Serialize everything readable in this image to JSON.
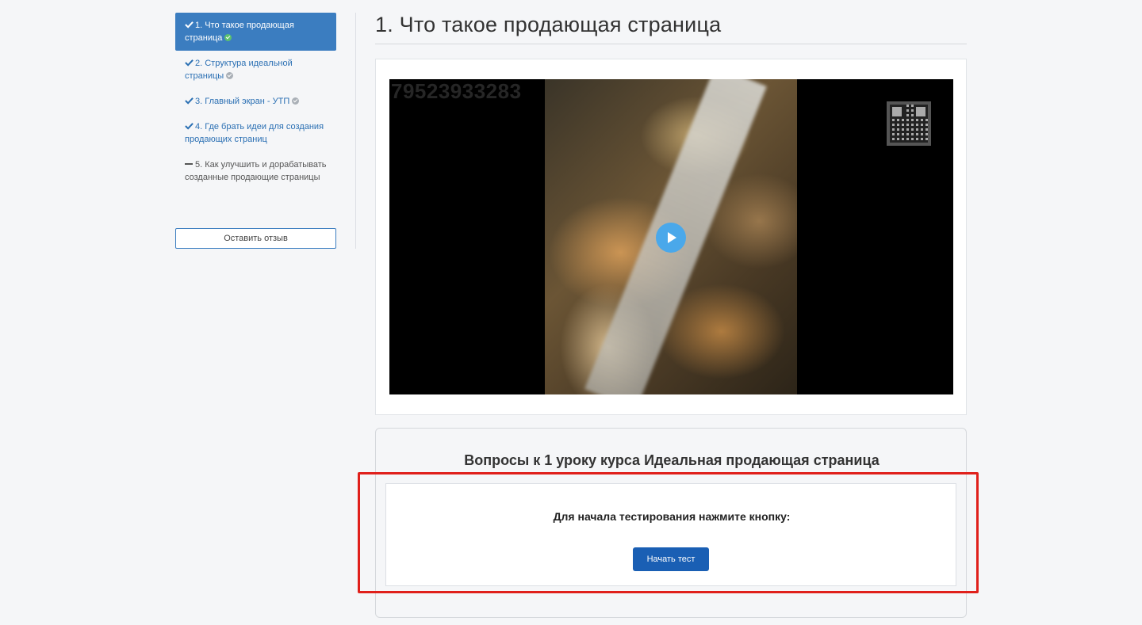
{
  "sidebar": {
    "items": [
      {
        "label": "1. Что такое продающая страница",
        "state": "done-active"
      },
      {
        "label": "2. Структура идеальной страницы",
        "state": "done"
      },
      {
        "label": "3. Главный экран - УТП",
        "state": "done"
      },
      {
        "label": "4. Где брать идеи для создания продающих страниц",
        "state": "done-nodot"
      },
      {
        "label": "5. Как улучшить и дорабатывать созданные продающие страницы",
        "state": "pending"
      }
    ],
    "feedback_label": "Оставить отзыв"
  },
  "main": {
    "title": "1. Что такое продающая страница",
    "video": {
      "watermark": "79523933283"
    }
  },
  "quiz": {
    "title": "Вопросы к 1 уроку курса Идеальная продающая страница",
    "prompt": "Для начала тестирования нажмите кнопку:",
    "start_label": "Начать тест"
  },
  "colors": {
    "accent": "#3b7dc0",
    "button": "#1a5fb4",
    "highlight": "#e0201b",
    "done_dot": "#5cc16d"
  }
}
